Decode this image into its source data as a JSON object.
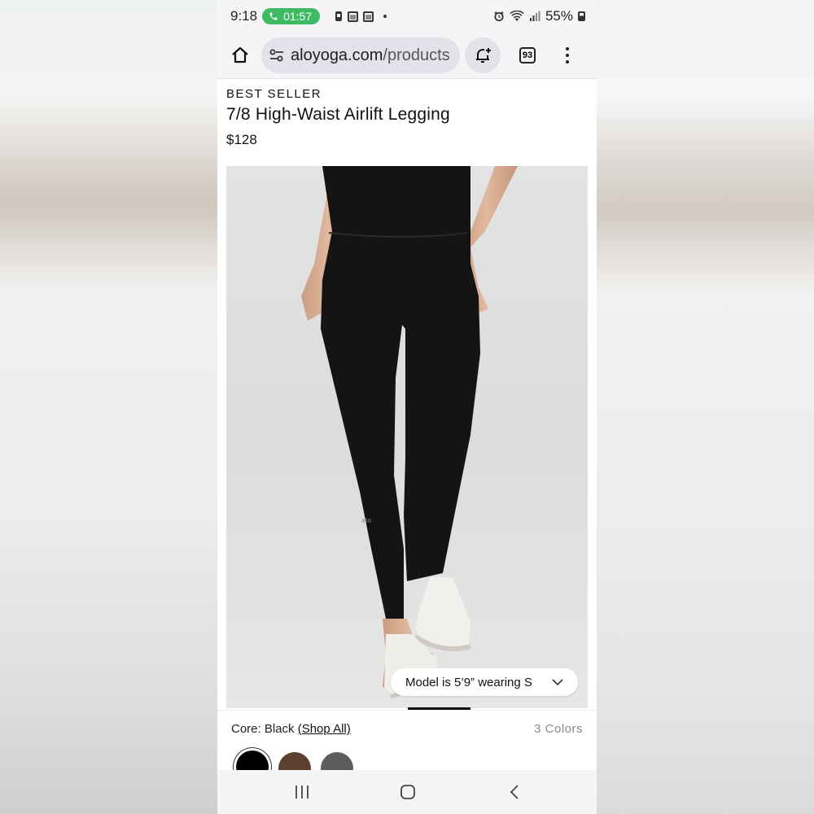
{
  "status_bar": {
    "time": "9:18",
    "call_duration": "01:57",
    "battery": "55%",
    "icons": [
      "phone-icon",
      "notification-icon",
      "news-icon",
      "news-icon-2",
      "alarm-icon",
      "wifi-icon",
      "signal-icon",
      "battery-icon"
    ]
  },
  "browser": {
    "url_domain": "aloyoga.com",
    "url_path": "/products",
    "tab_count": "93",
    "icons": [
      "home-icon",
      "site-settings-icon",
      "add-bell-icon",
      "tabs-icon",
      "more-vert-icon"
    ]
  },
  "product": {
    "badge": "BEST SELLER",
    "title": "7/8 High-Waist Airlift Legging",
    "price": "$128",
    "model_info": "Model is 5’9” wearing S"
  },
  "colors": {
    "label": "Core: Black",
    "shop_all": "(Shop All)",
    "count": "3 Colors",
    "swatches": [
      {
        "name": "black",
        "hex": "#000000",
        "selected": true
      },
      {
        "name": "brown",
        "hex": "#5b3f2f",
        "selected": false
      },
      {
        "name": "gray",
        "hex": "#5d5d5d",
        "selected": false
      }
    ]
  },
  "nav_bar": {
    "icons": [
      "recents-icon",
      "home-nav-icon",
      "back-icon"
    ]
  },
  "theme": {
    "call_green": "#3dba62",
    "toolbar_bg": "#f5f4f7",
    "url_bg": "#e2e2ea"
  }
}
